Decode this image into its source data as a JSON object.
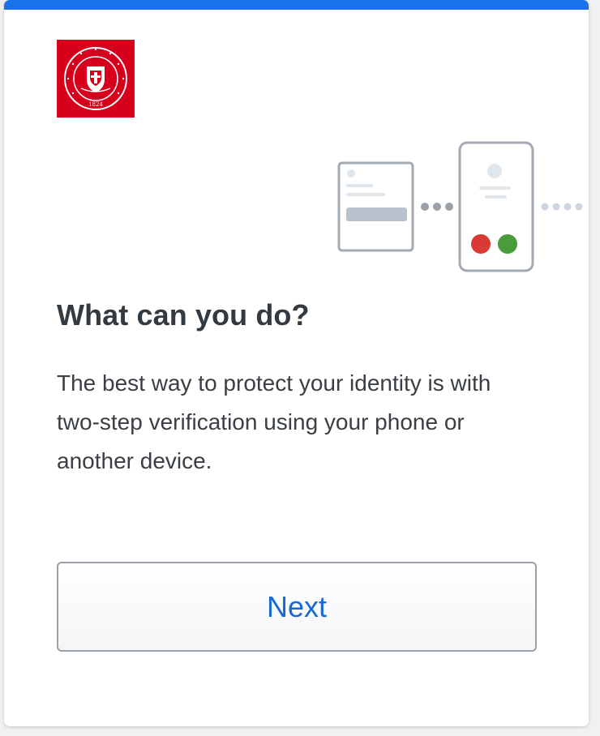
{
  "colors": {
    "accent": "#1a73e8",
    "brand_red": "#d6001c",
    "link_blue": "#1769d6",
    "deny_red": "#d93a35",
    "approve_green": "#4a9c3a"
  },
  "logo": {
    "name": "rensselaer-polytechnic-institute-seal",
    "ring_text": "RENSSELAER POLYTECHNIC INSTITUTE",
    "year": "1824"
  },
  "illustration": {
    "icons": [
      "browser-card-icon",
      "connection-dots-icon",
      "phone-icon",
      "deny-icon",
      "approve-icon"
    ]
  },
  "content": {
    "heading": "What can you do?",
    "body": "The best way to protect your identity is with two-step verification using your phone or another device."
  },
  "actions": {
    "next_label": "Next"
  }
}
